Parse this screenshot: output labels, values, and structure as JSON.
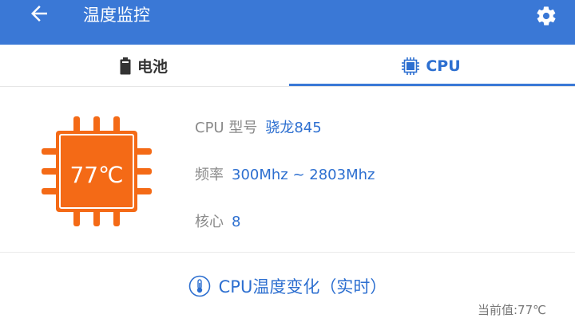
{
  "appbar": {
    "title": "温度监控",
    "back_icon": "arrow-left-icon",
    "settings_icon": "gear-icon"
  },
  "tabs": [
    {
      "label": "电池",
      "icon": "battery-icon",
      "active": false
    },
    {
      "label": "CPU",
      "icon": "cpu-chip-icon",
      "active": true
    }
  ],
  "cpu": {
    "temperature": "77℃",
    "model_label": "CPU 型号",
    "model_value": "骁龙845",
    "freq_label": "频率",
    "freq_value": "300Mhz ~ 2803Mhz",
    "cores_label": "核心",
    "cores_value": "8"
  },
  "chart_section": {
    "title": "CPU温度变化（实时）",
    "icon": "thermometer-icon",
    "current_value": "当前值:77℃"
  },
  "colors": {
    "primary": "#3a78d6",
    "accent_text": "#2d6fd0",
    "chip": "#f46a16"
  }
}
